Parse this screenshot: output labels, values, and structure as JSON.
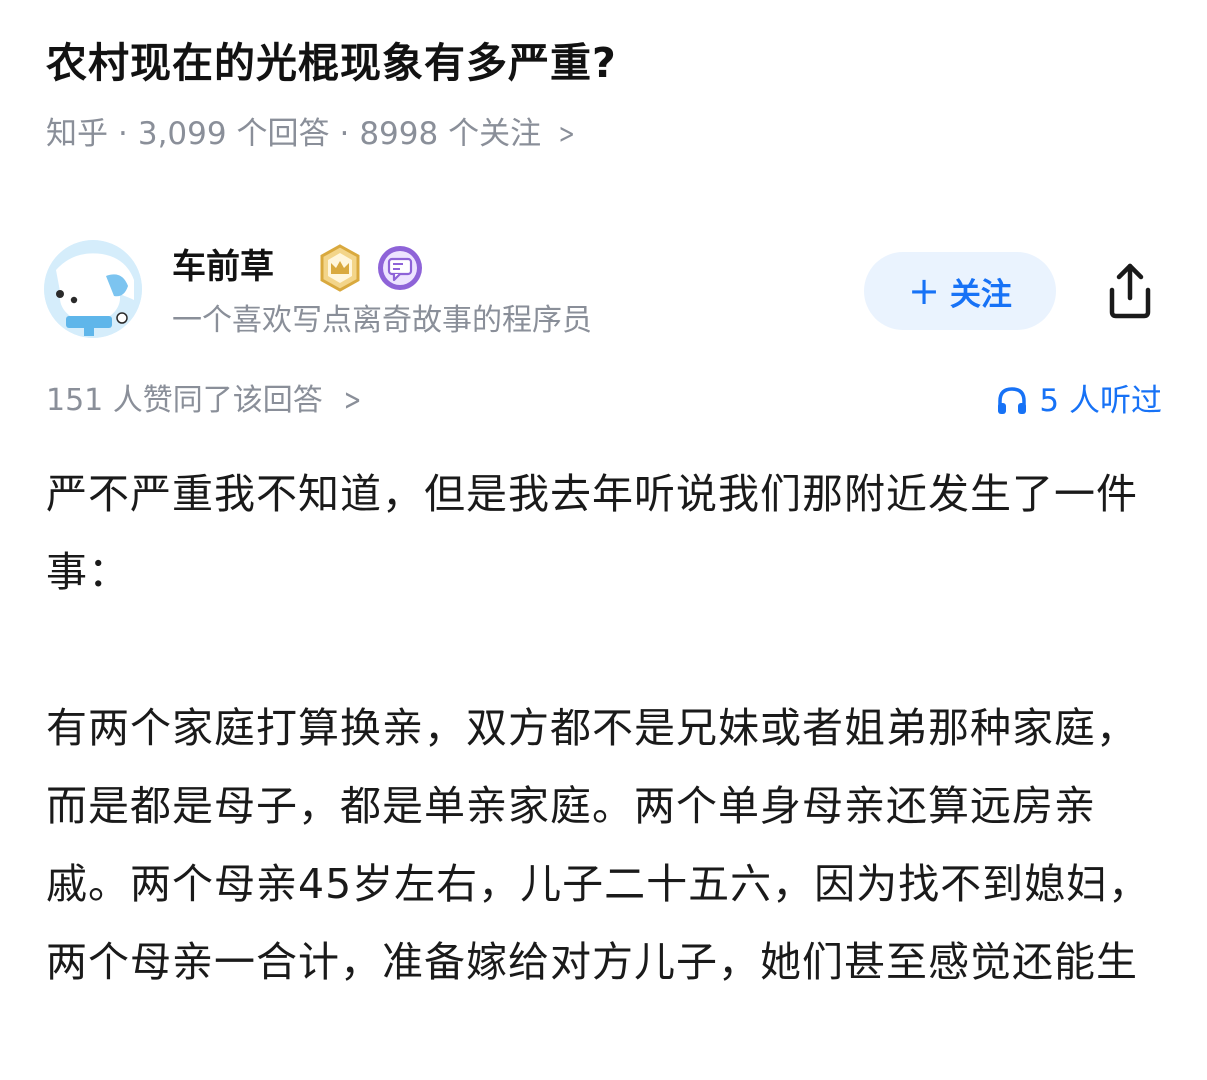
{
  "question": {
    "title": "农村现在的光棍现象有多严重?",
    "source": "知乎",
    "answers_count": "3,099 个回答",
    "followers_count": "8998 个关注"
  },
  "author": {
    "name": "车前草",
    "bio": "一个喜欢写点离奇故事的程序员",
    "follow_label": "关注"
  },
  "stats": {
    "votes_text": "151 人赞同了该回答",
    "listeners_text": "5 人听过"
  },
  "answer": {
    "paragraphs": [
      "严不严重我不知道，但是我去年听说我们那附近发生了一件事：",
      "有两个家庭打算换亲，双方都不是兄妹或者姐弟那种家庭，而是都是母子，都是单亲家庭。两个单身母亲还算远房亲戚。两个母亲45岁左右，儿子二十五六，因为找不到媳妇，两个母亲一合计，准备嫁给对方儿子，她们甚至感觉还能生"
    ]
  },
  "colors": {
    "accent": "#1772f6",
    "meta_gray": "#8a8f99",
    "follow_bg": "#eaf3fe"
  },
  "icons": {
    "crown_badge": "crown-badge-icon",
    "message_badge": "message-badge-icon",
    "share": "share-icon",
    "headphones": "headphones-icon",
    "chevron": "chevron-right-icon"
  }
}
